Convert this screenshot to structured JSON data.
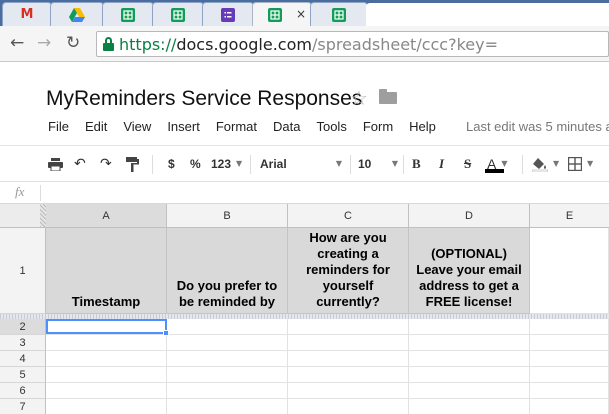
{
  "browser": {
    "tabs": [
      {
        "icon": "gmail-icon",
        "glyph": "M"
      },
      {
        "icon": "drive-icon",
        "glyph": ""
      },
      {
        "icon": "sheets-icon",
        "glyph": ""
      },
      {
        "icon": "sheets-icon",
        "glyph": ""
      },
      {
        "icon": "forms-icon",
        "glyph": ""
      },
      {
        "icon": "sheets-icon",
        "glyph": "",
        "active": true
      },
      {
        "icon": "sheets-icon",
        "glyph": ""
      }
    ],
    "tab_close": "×",
    "url": {
      "scheme": "https://",
      "host": "docs.google.com",
      "path": "/spreadsheet/ccc?key="
    }
  },
  "document": {
    "title": "MyReminders Service Responses",
    "star": "☆",
    "menu": [
      "File",
      "Edit",
      "View",
      "Insert",
      "Format",
      "Data",
      "Tools",
      "Form",
      "Help"
    ],
    "last_edit": "Last edit was 5 minutes ago"
  },
  "toolbar": {
    "currency": "$",
    "percent": "%",
    "number_format": "123",
    "font": "Arial",
    "font_size": "10",
    "bold": "B",
    "italic": "I",
    "strike": "S",
    "text_color": "A"
  },
  "formula_bar": {
    "fx": "fx",
    "value": ""
  },
  "sheet": {
    "columns": [
      "A",
      "B",
      "C",
      "D",
      "E"
    ],
    "rows": [
      "1",
      "2",
      "3",
      "4",
      "5",
      "6",
      "7"
    ],
    "header_row": [
      "Timestamp",
      "Do you prefer to be reminded by",
      "How are you creating a reminders for yourself currently?",
      "(OPTIONAL) Leave your email address to get a FREE license!",
      ""
    ],
    "selected_cell": "A2"
  },
  "colors": {
    "tabstrip": "#4a6da0",
    "header_fill": "#d9d9d9",
    "selection": "#4d90fe",
    "secure": "#0b8043"
  }
}
